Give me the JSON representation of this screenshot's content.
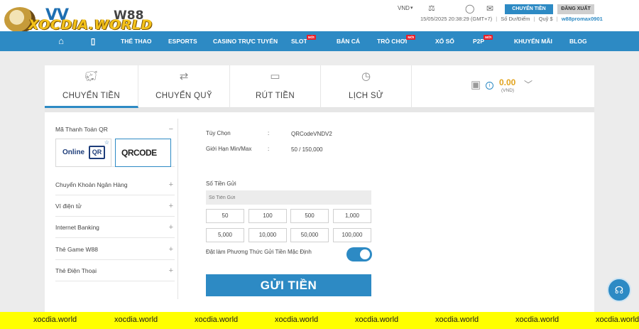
{
  "brand": {
    "name_top": "W88",
    "name_bottom": "XOCDIA.WORLD"
  },
  "topbar": {
    "language": "VND",
    "transfer_button": "CHUYỂN TIỀN",
    "logout_button": "ĐĂNG XUẤT",
    "datetime": "15/05/2025 20:38:29 (GMT+7)",
    "balance_label": "Số Dư/Điểm",
    "fund_label": "Quỹ $",
    "username": "w88promax0901"
  },
  "nav": {
    "items": [
      {
        "label": "THỂ THAO"
      },
      {
        "label": "ESPORTS"
      },
      {
        "label": "CASINO TRỰC TUYẾN"
      },
      {
        "label": "SLOT",
        "badge": "MỚI"
      },
      {
        "label": "BẮN CÁ"
      },
      {
        "label": "TRÒ CHƠI",
        "badge": "MỚI"
      },
      {
        "label": "XỔ SỐ"
      },
      {
        "label": "P2P",
        "badge": "MỚI"
      },
      {
        "label": "KHUYẾN MÃI"
      },
      {
        "label": "BLOG"
      }
    ]
  },
  "tabs": [
    {
      "label": "CHUYỂN TIỀN",
      "icon": "piggy-bank-icon",
      "active": true
    },
    {
      "label": "CHUYỂN QUỸ",
      "icon": "transfer-icon",
      "active": false
    },
    {
      "label": "RÚT TIỀN",
      "icon": "withdraw-icon",
      "active": false
    },
    {
      "label": "LỊCH SỬ",
      "icon": "history-icon",
      "active": false
    }
  ],
  "wallet": {
    "amount": "0.00",
    "currency": "(VND)"
  },
  "sidebar": {
    "methods": [
      {
        "label": "Mã Thanh Toán QR",
        "open": true
      },
      {
        "label": "Chuyển Khoản Ngân Hàng"
      },
      {
        "label": "Ví điện tử"
      },
      {
        "label": "Internet Banking"
      },
      {
        "label": "Thẻ Game W88"
      },
      {
        "label": "Thẻ Điện Thoại"
      }
    ],
    "qr_options": [
      {
        "label": "Online",
        "box": "QR"
      },
      {
        "label": "QRCODE"
      }
    ]
  },
  "form": {
    "option_label": "Tùy Chọn",
    "option_value": "QRCodeVNDV2",
    "limit_label": "Giới Hạn Min/Max",
    "limit_value": "50 / 150,000",
    "colon": ":",
    "amount_label": "Số Tiền Gửi",
    "amount_placeholder": "Số Tiền Gửi",
    "quick_amounts": [
      "50",
      "100",
      "500",
      "1,000",
      "5,000",
      "10,000",
      "50,000",
      "100,000"
    ],
    "default_label": "Đặt làm Phương Thức Gửi Tiền Mặc Định",
    "default_on": true,
    "submit_label": "GỬI TIỀN"
  },
  "watermark": {
    "text": "xocdia.world"
  },
  "colors": {
    "primary": "#2d8ac4",
    "wallet_amount": "#e2a31d",
    "watermark_bar": "#ffff00"
  }
}
